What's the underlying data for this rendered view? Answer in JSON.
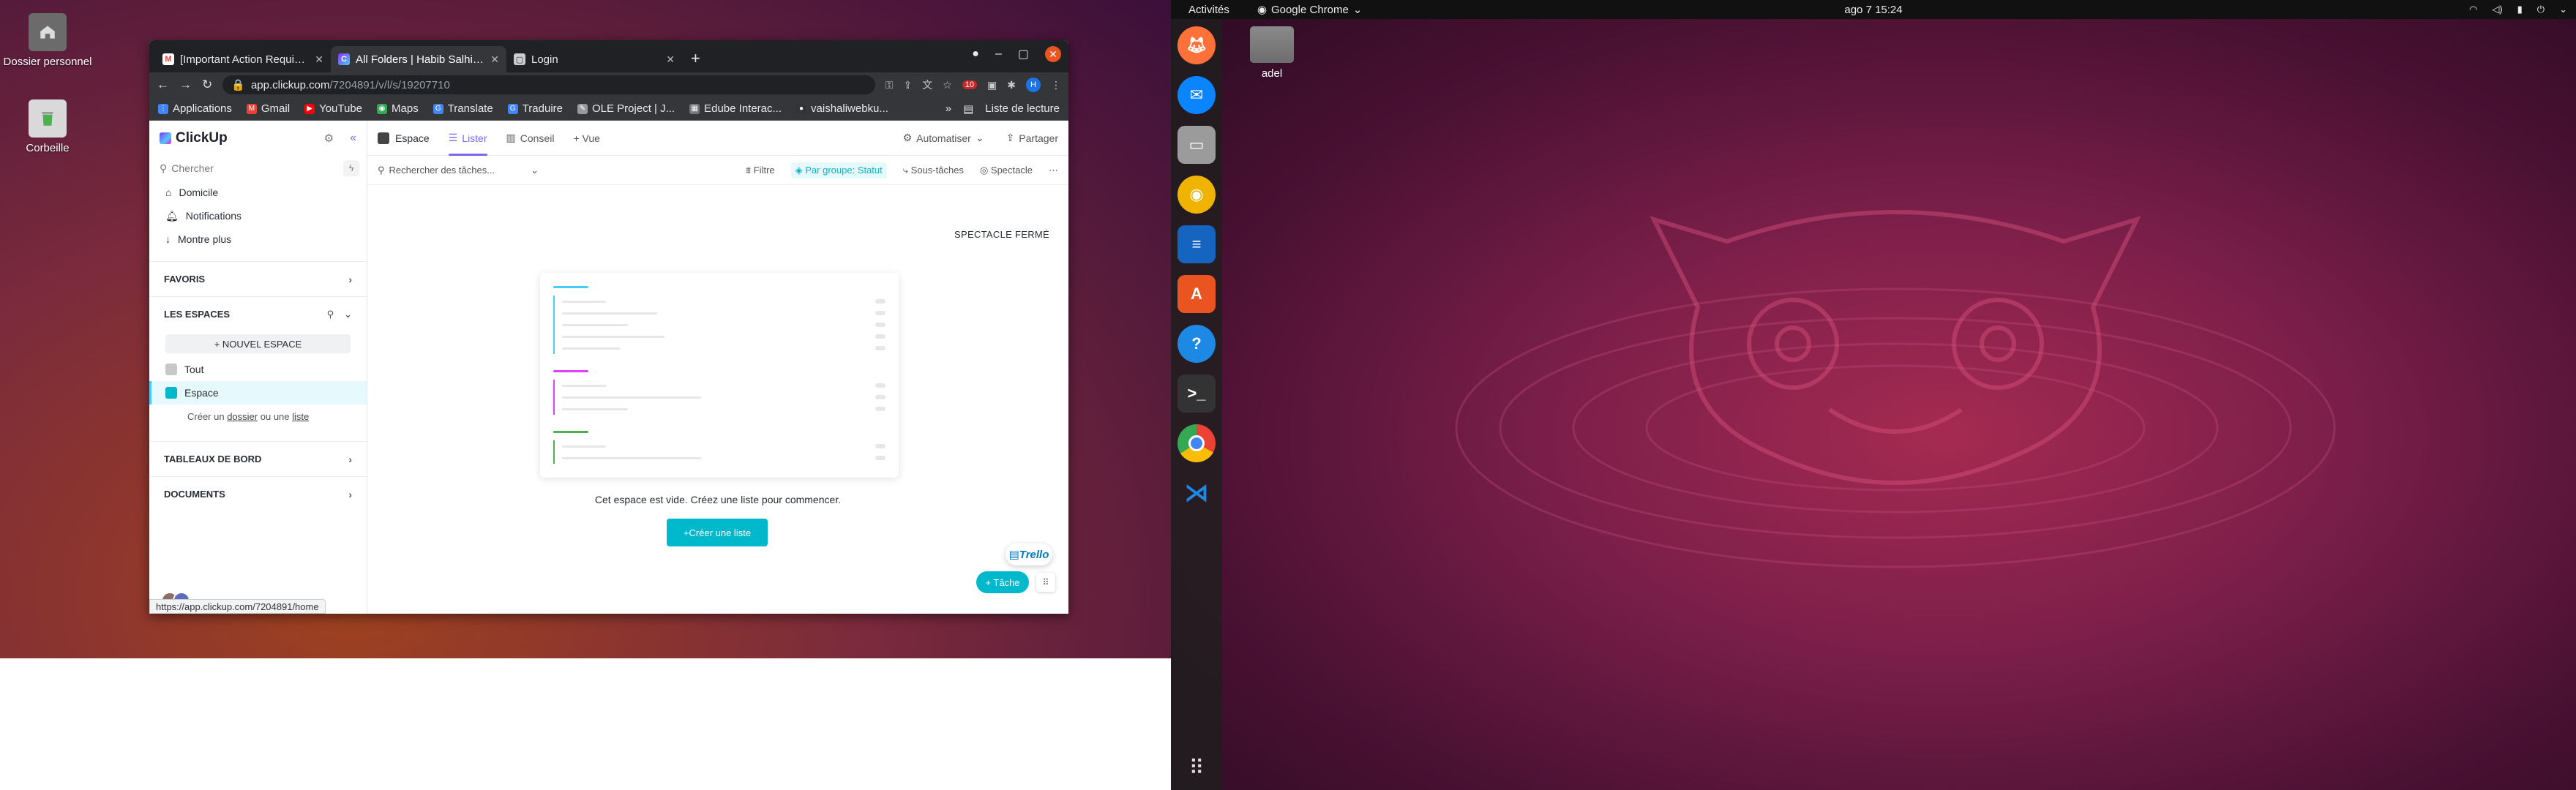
{
  "left_desktop": {
    "icons": [
      {
        "label": "Dossier personnel",
        "icon": "home-folder-icon"
      },
      {
        "label": "Corbeille",
        "icon": "trash-icon"
      }
    ]
  },
  "chrome": {
    "tabs": [
      {
        "title": "[Important Action Requi…",
        "icon": "gmail-icon",
        "active": false
      },
      {
        "title": "All Folders | Habib Salhi's…",
        "icon": "clickup-icon",
        "active": true
      },
      {
        "title": "Login",
        "icon": "page-icon",
        "active": false
      }
    ],
    "url_host": "app.clickup.com",
    "url_path": "/7204891/v/l/s/19207710",
    "profile_initial": "H",
    "ext_badge": "10",
    "bookmarks": [
      {
        "label": "Applications",
        "icon": "apps-grid-icon",
        "color": "#4285f4"
      },
      {
        "label": "Gmail",
        "icon": "gmail-icon",
        "color": "#ea4335"
      },
      {
        "label": "YouTube",
        "icon": "youtube-icon",
        "color": "#ff0000"
      },
      {
        "label": "Maps",
        "icon": "maps-icon",
        "color": "#34a853"
      },
      {
        "label": "Translate",
        "icon": "translate-icon",
        "color": "#4285f4"
      },
      {
        "label": "Traduire",
        "icon": "translate-icon",
        "color": "#4285f4"
      },
      {
        "label": "OLE Project | J...",
        "icon": "pen-icon",
        "color": "#999999"
      },
      {
        "label": "Edube Interac...",
        "icon": "grid-icon",
        "color": "#777777"
      },
      {
        "label": "vaishaliwebku...",
        "icon": "github-icon",
        "color": "#333333"
      }
    ],
    "more_bookmarks": "»",
    "reading_list": "Liste de lecture",
    "status_url": "https://app.clickup.com/7204891/home"
  },
  "clickup": {
    "logo": "ClickUp",
    "search_placeholder": "Chercher",
    "nav": [
      {
        "label": "Domicile",
        "icon": "home-icon"
      },
      {
        "label": "Notifications",
        "icon": "bell-icon"
      },
      {
        "label": "Montre plus",
        "icon": "arrow-down-icon"
      }
    ],
    "favorites": "FAVORIS",
    "spaces_title": "LES ESPACES",
    "new_space": "+ NOUVEL ESPACE",
    "spaces": [
      {
        "label": "Tout",
        "color": "#c8c8c8"
      },
      {
        "label": "Espace",
        "color": "#00b8cc"
      }
    ],
    "hint": {
      "before": "Créer un",
      "folder": "dossier",
      "middle": "ou une",
      "list": "liste"
    },
    "dashboards": "TABLEAUX DE BORD",
    "documents": "DOCUMENTS",
    "header": {
      "space": "Espace",
      "views": [
        "Lister",
        "Conseil"
      ],
      "add_view": "+ Vue",
      "automate": "Automatiser",
      "share": "Partager"
    },
    "subbar": {
      "search": "Rechercher des tâches...",
      "filter": "Filtre",
      "group": "Par groupe: Statut",
      "subtasks": "Sous-tâches",
      "show": "Spectacle"
    },
    "closed_label": "SPECTACLE FERMÉ",
    "empty_message": "Cet espace est vide. Créez une liste pour commencer.",
    "create_list": "+Créer une liste",
    "trello": "Trello",
    "task_button": "+ Tâche",
    "colors": {
      "accent": "#7b68ee",
      "teal": "#00b8cc"
    }
  },
  "ubuntu": {
    "activities": "Activités",
    "app_menu": "Google Chrome",
    "clock": "ago 7  15:24",
    "home_folder": "adel",
    "dock": [
      {
        "icon": "firefox-icon",
        "color": "#ff7139"
      },
      {
        "icon": "thunderbird-icon",
        "color": "#0a84ff"
      },
      {
        "icon": "files-icon",
        "color": "#9b9b9b"
      },
      {
        "icon": "rhythmbox-icon",
        "color": "#f0b400"
      },
      {
        "icon": "writer-icon",
        "color": "#1565c0"
      },
      {
        "icon": "software-icon",
        "color": "#e95420"
      },
      {
        "icon": "help-icon",
        "color": "#1e88e5"
      },
      {
        "icon": "terminal-icon",
        "color": "#333333"
      },
      {
        "icon": "chrome-icon",
        "color": "#4285f4"
      },
      {
        "icon": "vscode-icon",
        "color": "#1e88e5"
      }
    ]
  }
}
